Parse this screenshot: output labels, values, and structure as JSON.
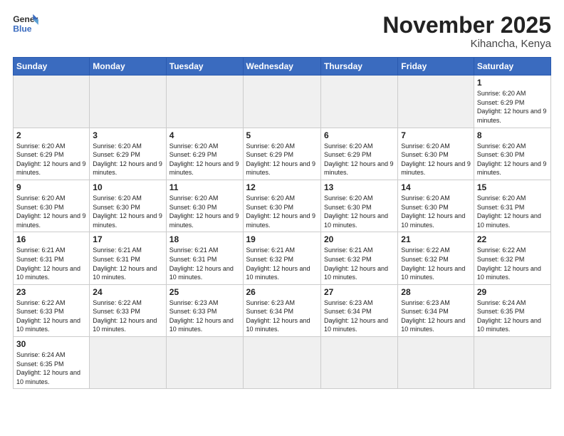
{
  "header": {
    "logo_general": "General",
    "logo_blue": "Blue",
    "month_title": "November 2025",
    "location": "Kihancha, Kenya"
  },
  "weekdays": [
    "Sunday",
    "Monday",
    "Tuesday",
    "Wednesday",
    "Thursday",
    "Friday",
    "Saturday"
  ],
  "weeks": [
    [
      {
        "day": "",
        "info": ""
      },
      {
        "day": "",
        "info": ""
      },
      {
        "day": "",
        "info": ""
      },
      {
        "day": "",
        "info": ""
      },
      {
        "day": "",
        "info": ""
      },
      {
        "day": "",
        "info": ""
      },
      {
        "day": "1",
        "info": "Sunrise: 6:20 AM\nSunset: 6:29 PM\nDaylight: 12 hours and 9 minutes."
      }
    ],
    [
      {
        "day": "2",
        "info": "Sunrise: 6:20 AM\nSunset: 6:29 PM\nDaylight: 12 hours and 9 minutes."
      },
      {
        "day": "3",
        "info": "Sunrise: 6:20 AM\nSunset: 6:29 PM\nDaylight: 12 hours and 9 minutes."
      },
      {
        "day": "4",
        "info": "Sunrise: 6:20 AM\nSunset: 6:29 PM\nDaylight: 12 hours and 9 minutes."
      },
      {
        "day": "5",
        "info": "Sunrise: 6:20 AM\nSunset: 6:29 PM\nDaylight: 12 hours and 9 minutes."
      },
      {
        "day": "6",
        "info": "Sunrise: 6:20 AM\nSunset: 6:29 PM\nDaylight: 12 hours and 9 minutes."
      },
      {
        "day": "7",
        "info": "Sunrise: 6:20 AM\nSunset: 6:30 PM\nDaylight: 12 hours and 9 minutes."
      },
      {
        "day": "8",
        "info": "Sunrise: 6:20 AM\nSunset: 6:30 PM\nDaylight: 12 hours and 9 minutes."
      }
    ],
    [
      {
        "day": "9",
        "info": "Sunrise: 6:20 AM\nSunset: 6:30 PM\nDaylight: 12 hours and 9 minutes."
      },
      {
        "day": "10",
        "info": "Sunrise: 6:20 AM\nSunset: 6:30 PM\nDaylight: 12 hours and 9 minutes."
      },
      {
        "day": "11",
        "info": "Sunrise: 6:20 AM\nSunset: 6:30 PM\nDaylight: 12 hours and 9 minutes."
      },
      {
        "day": "12",
        "info": "Sunrise: 6:20 AM\nSunset: 6:30 PM\nDaylight: 12 hours and 9 minutes."
      },
      {
        "day": "13",
        "info": "Sunrise: 6:20 AM\nSunset: 6:30 PM\nDaylight: 12 hours and 10 minutes."
      },
      {
        "day": "14",
        "info": "Sunrise: 6:20 AM\nSunset: 6:30 PM\nDaylight: 12 hours and 10 minutes."
      },
      {
        "day": "15",
        "info": "Sunrise: 6:20 AM\nSunset: 6:31 PM\nDaylight: 12 hours and 10 minutes."
      }
    ],
    [
      {
        "day": "16",
        "info": "Sunrise: 6:21 AM\nSunset: 6:31 PM\nDaylight: 12 hours and 10 minutes."
      },
      {
        "day": "17",
        "info": "Sunrise: 6:21 AM\nSunset: 6:31 PM\nDaylight: 12 hours and 10 minutes."
      },
      {
        "day": "18",
        "info": "Sunrise: 6:21 AM\nSunset: 6:31 PM\nDaylight: 12 hours and 10 minutes."
      },
      {
        "day": "19",
        "info": "Sunrise: 6:21 AM\nSunset: 6:32 PM\nDaylight: 12 hours and 10 minutes."
      },
      {
        "day": "20",
        "info": "Sunrise: 6:21 AM\nSunset: 6:32 PM\nDaylight: 12 hours and 10 minutes."
      },
      {
        "day": "21",
        "info": "Sunrise: 6:22 AM\nSunset: 6:32 PM\nDaylight: 12 hours and 10 minutes."
      },
      {
        "day": "22",
        "info": "Sunrise: 6:22 AM\nSunset: 6:32 PM\nDaylight: 12 hours and 10 minutes."
      }
    ],
    [
      {
        "day": "23",
        "info": "Sunrise: 6:22 AM\nSunset: 6:33 PM\nDaylight: 12 hours and 10 minutes."
      },
      {
        "day": "24",
        "info": "Sunrise: 6:22 AM\nSunset: 6:33 PM\nDaylight: 12 hours and 10 minutes."
      },
      {
        "day": "25",
        "info": "Sunrise: 6:23 AM\nSunset: 6:33 PM\nDaylight: 12 hours and 10 minutes."
      },
      {
        "day": "26",
        "info": "Sunrise: 6:23 AM\nSunset: 6:34 PM\nDaylight: 12 hours and 10 minutes."
      },
      {
        "day": "27",
        "info": "Sunrise: 6:23 AM\nSunset: 6:34 PM\nDaylight: 12 hours and 10 minutes."
      },
      {
        "day": "28",
        "info": "Sunrise: 6:23 AM\nSunset: 6:34 PM\nDaylight: 12 hours and 10 minutes."
      },
      {
        "day": "29",
        "info": "Sunrise: 6:24 AM\nSunset: 6:35 PM\nDaylight: 12 hours and 10 minutes."
      }
    ],
    [
      {
        "day": "30",
        "info": "Sunrise: 6:24 AM\nSunset: 6:35 PM\nDaylight: 12 hours and 10 minutes."
      },
      {
        "day": "",
        "info": ""
      },
      {
        "day": "",
        "info": ""
      },
      {
        "day": "",
        "info": ""
      },
      {
        "day": "",
        "info": ""
      },
      {
        "day": "",
        "info": ""
      },
      {
        "day": "",
        "info": ""
      }
    ]
  ]
}
